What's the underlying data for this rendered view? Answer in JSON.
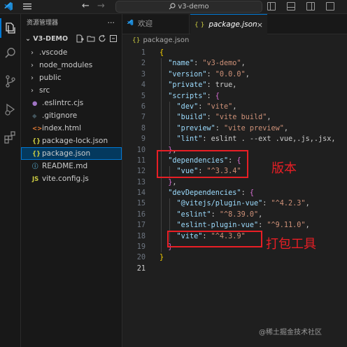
{
  "titlebar": {
    "search_text": "v3-demo",
    "back_icon": "arrow-left-icon",
    "forward_icon": "arrow-right-icon"
  },
  "activity_bar": {
    "items": [
      "explorer-icon",
      "search-icon",
      "source-control-icon",
      "run-debug-icon",
      "extensions-icon"
    ]
  },
  "sidebar": {
    "title": "资源管理器",
    "more": "···",
    "folder_name": "V3-DEMO",
    "items": [
      {
        "type": "folder",
        "label": ".vscode"
      },
      {
        "type": "folder",
        "label": "node_modules"
      },
      {
        "type": "folder",
        "label": "public"
      },
      {
        "type": "folder",
        "label": "src"
      },
      {
        "type": "file",
        "label": ".eslintrc.cjs",
        "icon": "eslint-icon"
      },
      {
        "type": "file",
        "label": ".gitignore",
        "icon": "git-icon"
      },
      {
        "type": "file",
        "label": "index.html",
        "icon": "html-icon"
      },
      {
        "type": "file",
        "label": "package-lock.json",
        "icon": "json-icon"
      },
      {
        "type": "file",
        "label": "package.json",
        "icon": "json-icon",
        "selected": true
      },
      {
        "type": "file",
        "label": "README.md",
        "icon": "info-icon"
      },
      {
        "type": "file",
        "label": "vite.config.js",
        "icon": "js-icon"
      }
    ]
  },
  "tabs": [
    {
      "label": "欢迎",
      "active": false
    },
    {
      "label": "package.json",
      "active": true,
      "close": "×"
    }
  ],
  "breadcrumb": {
    "label": "package.json"
  },
  "editor": {
    "lines": [
      "{",
      "  \"name\": \"v3-demo\",",
      "  \"version\": \"0.0.0\",",
      "  \"private\": true,",
      "  \"scripts\": {",
      "    \"dev\": \"vite\",",
      "    \"build\": \"vite build\",",
      "    \"preview\": \"vite preview\",",
      "    \"lint\": \"eslint . --ext .vue,.js,.jsx,",
      "  },",
      "  \"dependencies\": {",
      "    \"vue\": \"^3.3.4\"",
      "  },",
      "  \"devDependencies\": {",
      "    \"@vitejs/plugin-vue\": \"^4.2.3\",",
      "    \"eslint\": \"^8.39.0\",",
      "    \"eslint-plugin-vue\": \"^9.11.0\",",
      "    \"vite\": \"^4.3.9\"",
      "  }",
      "}",
      ""
    ]
  },
  "annotations": {
    "label1": "版本",
    "label2": "打包工具"
  },
  "watermark": "@稀土掘金技术社区",
  "colors": {
    "accent": "#0078d4",
    "annotation": "#e81e25",
    "key": "#9cdcfe",
    "string": "#ce9178",
    "keyword": "#569cd6"
  }
}
